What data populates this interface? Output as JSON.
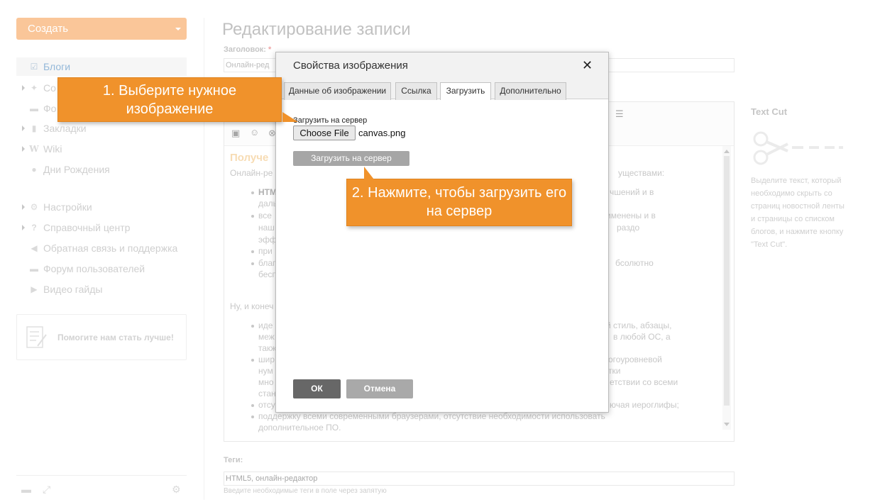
{
  "sidebar": {
    "create_label": "Создать",
    "items": [
      {
        "label": "Блоги",
        "icon": "edit-icon",
        "active": true
      },
      {
        "label": "Со",
        "icon": "pin-icon"
      },
      {
        "label": "Фо",
        "icon": "chat-icon"
      },
      {
        "label": "Закладки",
        "icon": "bookmark-icon"
      },
      {
        "label": "Wiki",
        "icon": "wiki-icon"
      },
      {
        "label": "Дни Рождения",
        "icon": "people-icon"
      },
      {
        "label": "Настройки",
        "icon": "gear-icon"
      },
      {
        "label": "Справочный центр",
        "icon": "question-icon"
      },
      {
        "label": "Обратная связь и поддержка",
        "icon": "megaphone-icon"
      },
      {
        "label": "Форум пользователей",
        "icon": "forum-icon"
      },
      {
        "label": "Видео гайды",
        "icon": "video-icon"
      }
    ],
    "feedback_label": "Помогите нам стать лучше!"
  },
  "main": {
    "title": "Редактирование записи",
    "title_field_label": "Заголовок:",
    "required_mark": "*",
    "title_value": "Онлайн-ред",
    "content": {
      "heading": "Получе",
      "intro": "Онлайн-ре",
      "intro_end": "уществами:",
      "lines": [
        {
          "left": "HTM",
          "right": "чшений и в"
        },
        {
          "left": "даль",
          "right": ""
        },
        {
          "left": "все",
          "right": "именены и в"
        },
        {
          "left": "наш",
          "right": "раздо"
        },
        {
          "left": "эфф",
          "right": ""
        },
        {
          "left": "при",
          "right": ""
        },
        {
          "left": "благ",
          "right": "бсолютно"
        },
        {
          "left": "бесп",
          "right": ""
        }
      ],
      "para2": "Ну, и конеч",
      "lines2": [
        {
          "left": "иде",
          "right": "й стиль, абзацы,"
        },
        {
          "left": "меж",
          "right": "в любой ОС, а"
        },
        {
          "left": "такж",
          "right": ""
        },
        {
          "left": "шир",
          "right": "огоуровневой"
        },
        {
          "left": "нум",
          "right": "тки"
        },
        {
          "left": "мно",
          "right": "етствии со всеми"
        },
        {
          "left": "стан",
          "right": ""
        },
        {
          "left": "отсу",
          "right": "ючая иероглифы;"
        }
      ],
      "last_line": "поддержку всеми современными браузерами, отсутствие необходимости использовать",
      "last_line2": "дополнительное ПО."
    },
    "tags_label": "Теги:",
    "tags_value": "HTML5, онлайн-редактор",
    "tags_hint": "Введите необходимые теги в поле через запятую"
  },
  "right_panel": {
    "title": "Text Cut",
    "description": "Выделите текст, который необходимо скрыть со страниц новостной ленты и страницы со списком блогов, и нажмите кнопку \"Text Cut\"."
  },
  "dialog": {
    "title": "Свойства изображения",
    "close_symbol": "✕",
    "tabs": [
      {
        "label": "Данные об изображении",
        "active": false
      },
      {
        "label": "Ссылка",
        "active": false
      },
      {
        "label": "Загрузить",
        "active": true
      },
      {
        "label": "Дополнительно",
        "active": false
      }
    ],
    "upload_label": "Загрузить на сервер",
    "choose_file_label": "Choose File",
    "file_name": "canvas.png",
    "upload_button_label": "Загрузить на сервер",
    "ok_label": "ОК",
    "cancel_label": "Отмена"
  },
  "callouts": {
    "step1": "1. Выберите нужное изображение",
    "step2": "2. Нажмите, чтобы загрузить его на сервер"
  },
  "colors": {
    "accent": "#f7a863",
    "callout": "#f0922b",
    "link": "#5b93c5"
  }
}
